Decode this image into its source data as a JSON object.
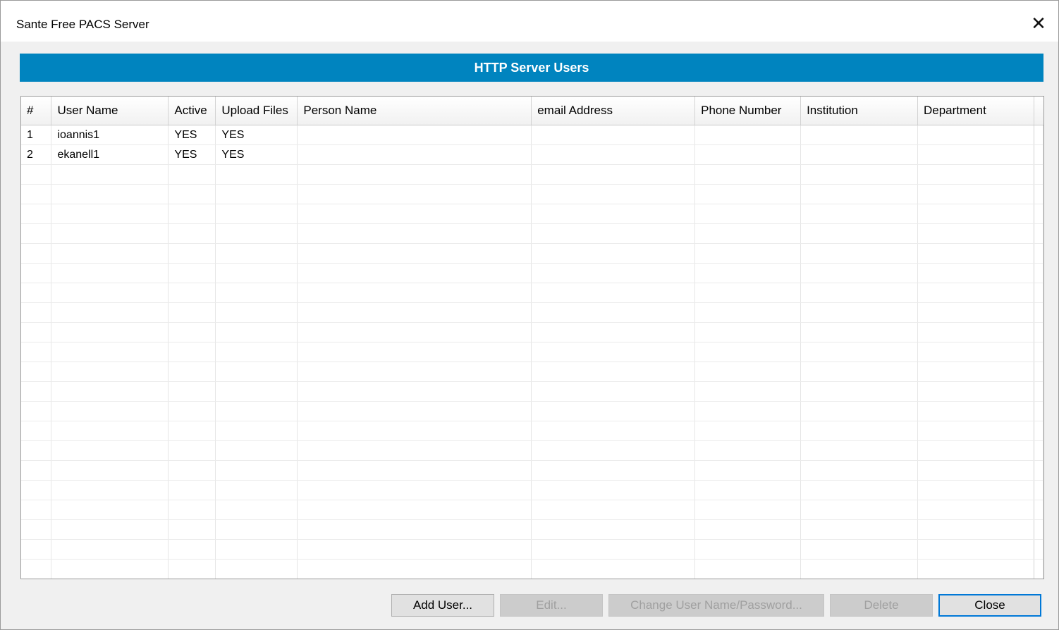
{
  "window": {
    "title": "Sante Free PACS Server",
    "close_glyph": "✕"
  },
  "banner": {
    "title": "HTTP Server Users"
  },
  "table": {
    "columns": [
      "#",
      "User Name",
      "Active",
      "Upload Files",
      "Person Name",
      "email Address",
      "Phone Number",
      "Institution",
      "Department"
    ],
    "rows": [
      [
        "1",
        "ioannis1",
        "YES",
        "YES",
        "",
        "",
        "",
        "",
        ""
      ],
      [
        "2",
        "ekanell1",
        "YES",
        "YES",
        "",
        "",
        "",
        "",
        ""
      ]
    ],
    "empty_row_count": 21
  },
  "buttons": {
    "add_user": "Add User...",
    "edit": "Edit...",
    "change": "Change User Name/Password...",
    "delete": "Delete",
    "close": "Close"
  },
  "colors": {
    "banner": "#0084bf",
    "dialog_bg": "#f0f0f0",
    "default_button_border": "#0078d7"
  }
}
